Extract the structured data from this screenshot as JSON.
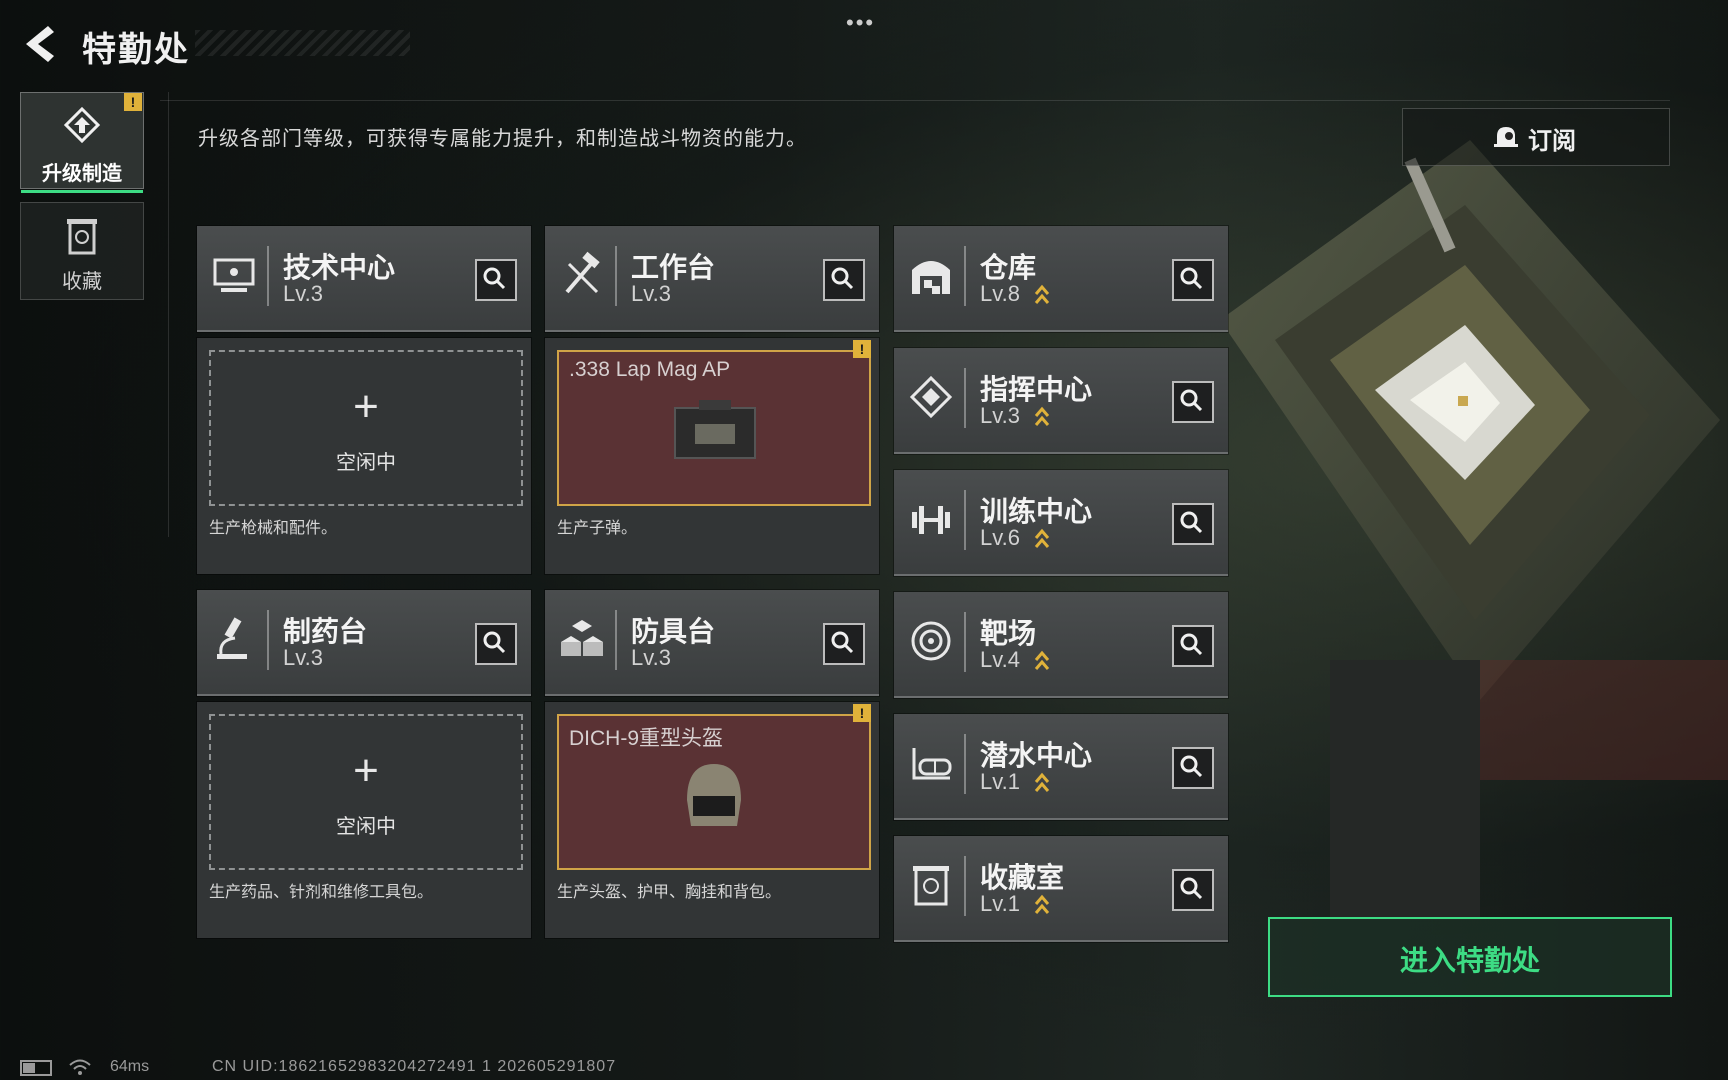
{
  "header": {
    "title": "特勤处",
    "description": "升级各部门等级，可获得专属能力提升，和制造战斗物资的能力。",
    "subscribe_label": "订阅",
    "badge": "!"
  },
  "sidebar": {
    "items": [
      {
        "label": "升级制造",
        "active": true
      },
      {
        "label": "收藏",
        "active": false
      }
    ]
  },
  "workbenches": [
    {
      "name": "技术中心",
      "level": "Lv.3",
      "slot_empty": true,
      "slot_plus": "+",
      "slot_state": "空闲中",
      "desc": "生产枪械和配件。"
    },
    {
      "name": "工作台",
      "level": "Lv.3",
      "slot_empty": false,
      "item_name": ".338 Lap Mag AP",
      "desc": "生产子弹。"
    },
    {
      "name": "制药台",
      "level": "Lv.3",
      "slot_empty": true,
      "slot_plus": "+",
      "slot_state": "空闲中",
      "desc": "生产药品、针剂和维修工具包。"
    },
    {
      "name": "防具台",
      "level": "Lv.3",
      "slot_empty": false,
      "item_name": "DICH-9重型头盔",
      "desc": "生产头盔、护甲、胸挂和背包。"
    }
  ],
  "facilities": [
    {
      "name": "仓库",
      "level": "Lv.8",
      "upgradable": true
    },
    {
      "name": "指挥中心",
      "level": "Lv.3",
      "upgradable": true
    },
    {
      "name": "训练中心",
      "level": "Lv.6",
      "upgradable": true
    },
    {
      "name": "靶场",
      "level": "Lv.4",
      "upgradable": true
    },
    {
      "name": "潜水中心",
      "level": "Lv.1",
      "upgradable": true
    },
    {
      "name": "收藏室",
      "level": "Lv.1",
      "upgradable": true
    }
  ],
  "enter_button": "进入特勤处",
  "status_bar": {
    "ping": "64ms",
    "uid": "CN UID:18621652983204272491 1 202605291807"
  },
  "colors": {
    "accent_green": "#3ddc84",
    "badge_yellow": "#e0b23a",
    "item_border": "#d0a447",
    "item_bg": "#5a3234"
  }
}
